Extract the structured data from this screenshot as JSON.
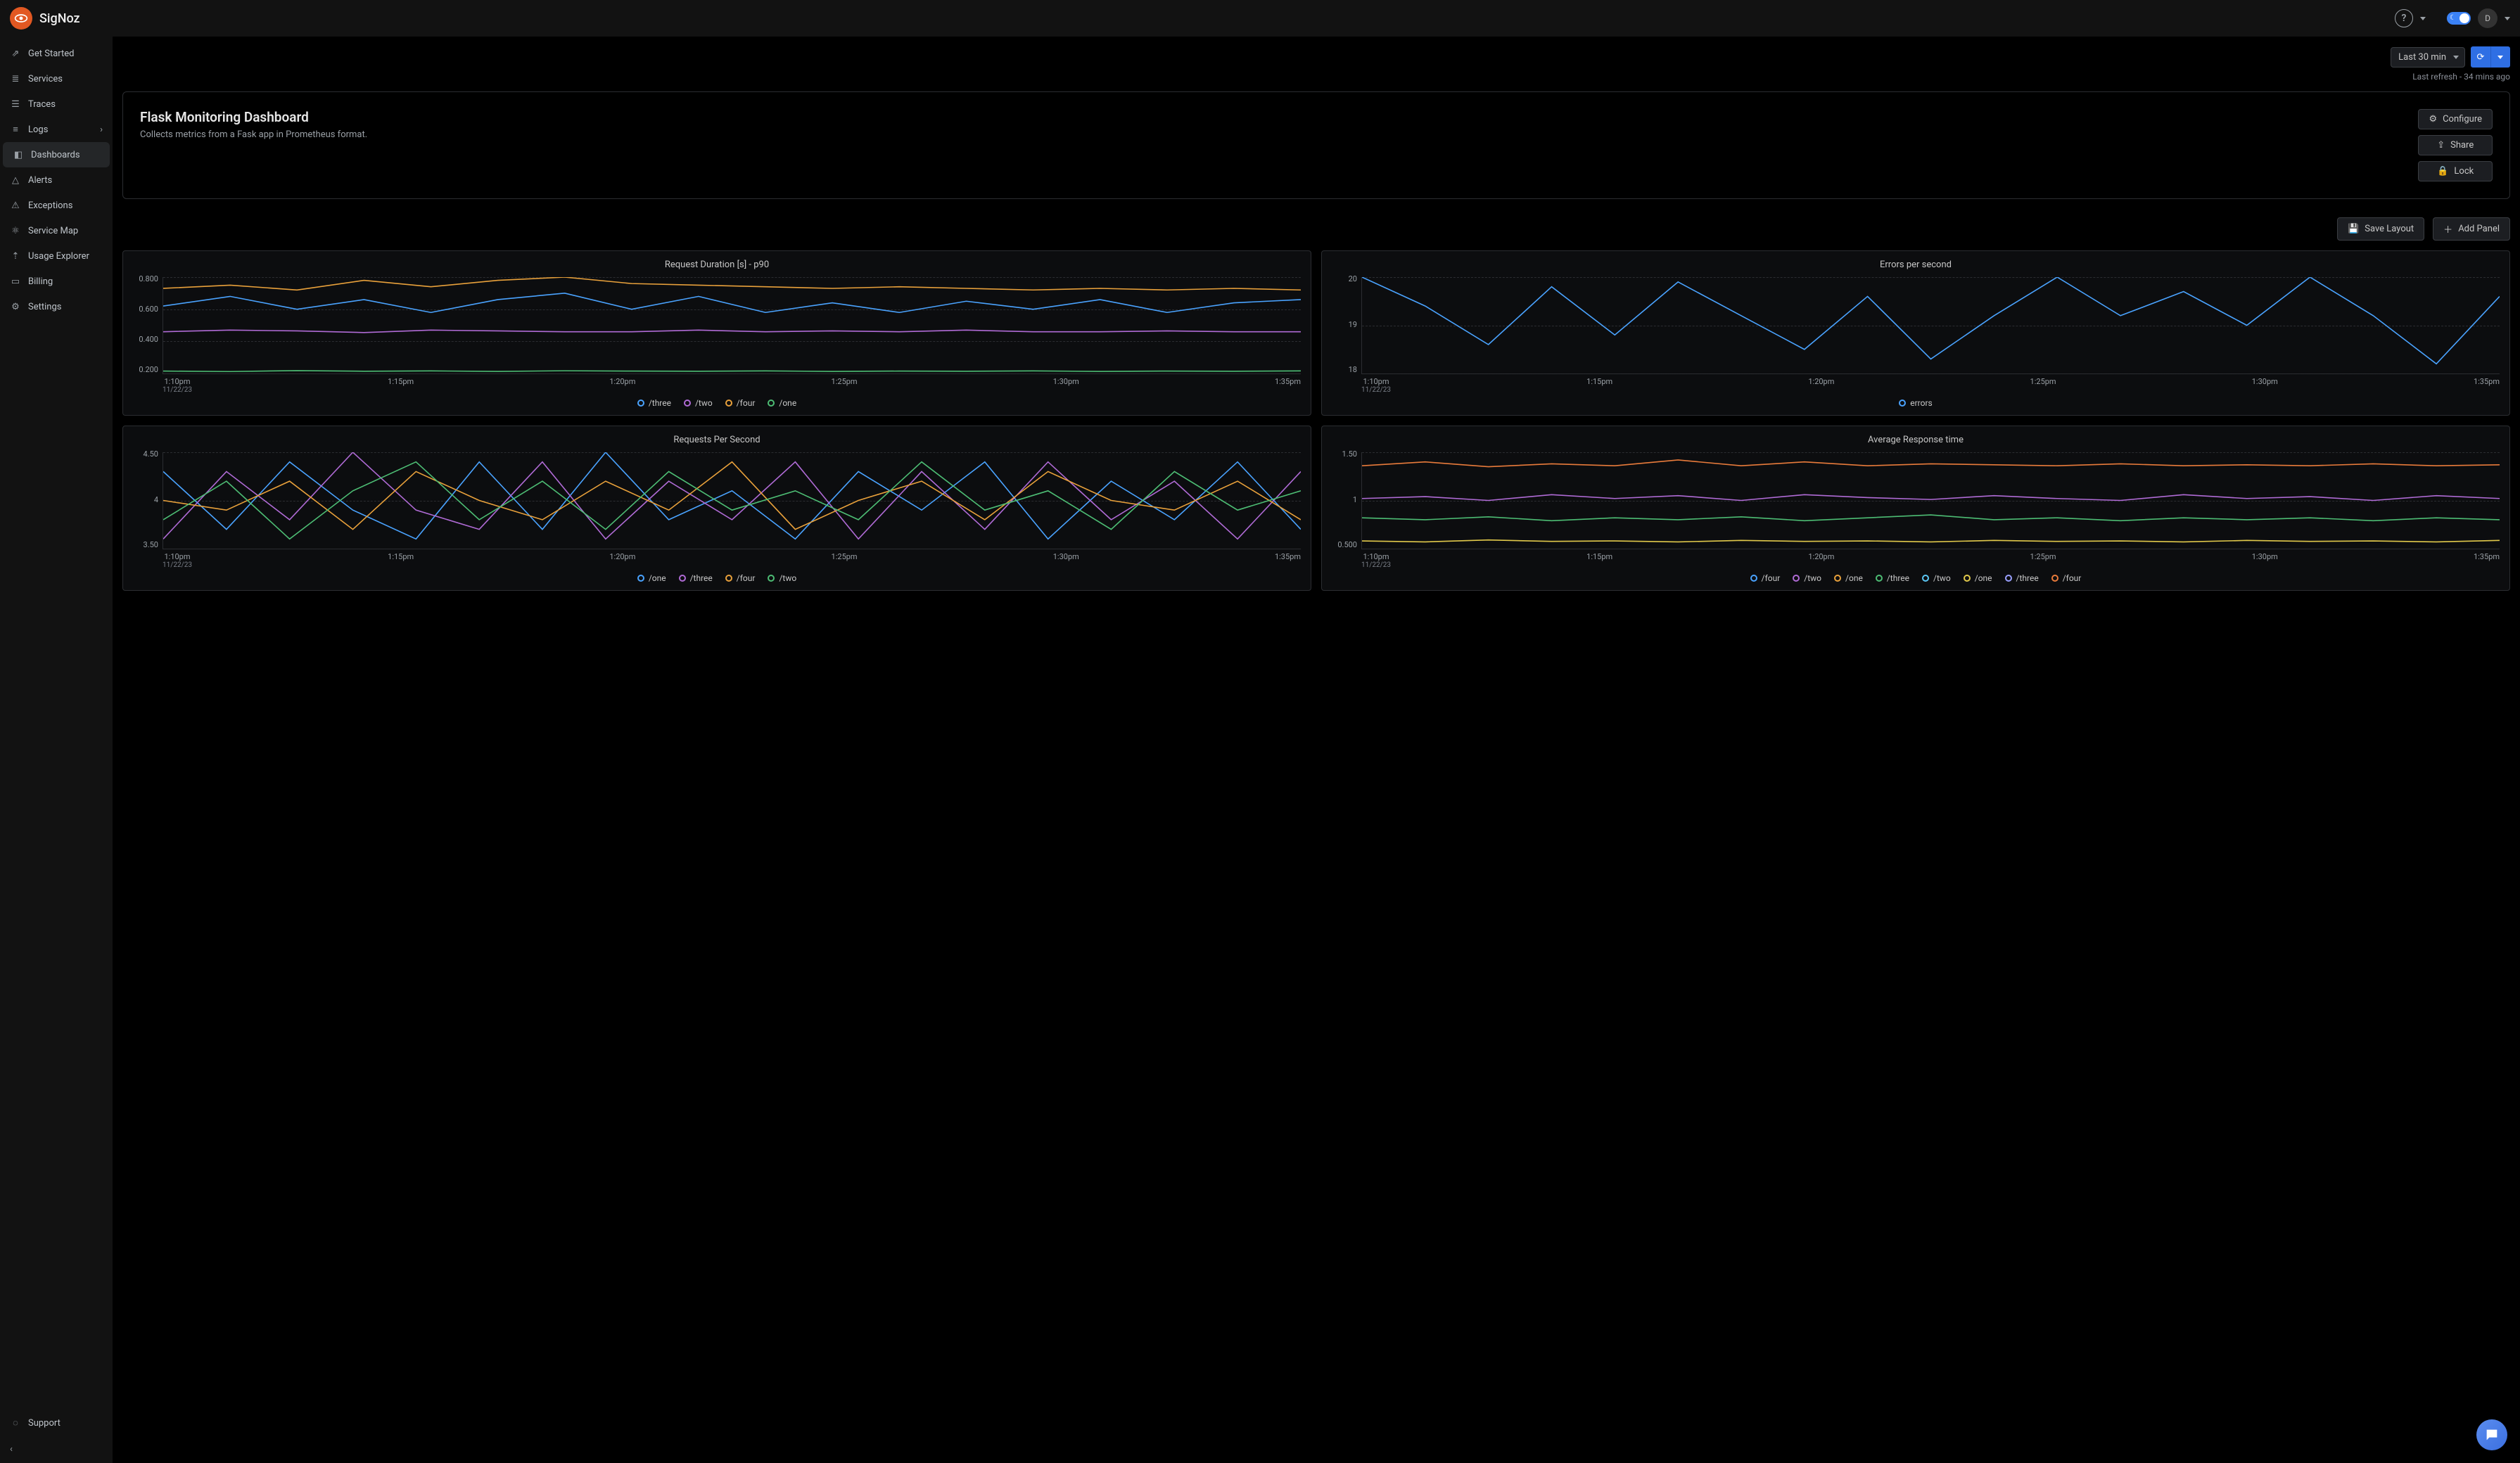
{
  "brand": "SigNoz",
  "header": {
    "help_tooltip": "Help",
    "theme": "dark",
    "avatar_initial": "D"
  },
  "sidebar": {
    "items": [
      {
        "label": "Get Started",
        "icon": "rocket-icon"
      },
      {
        "label": "Services",
        "icon": "bars-icon"
      },
      {
        "label": "Traces",
        "icon": "list-icon"
      },
      {
        "label": "Logs",
        "icon": "lines-icon",
        "has_submenu": true
      },
      {
        "label": "Dashboards",
        "icon": "dashboard-icon",
        "active": true
      },
      {
        "label": "Alerts",
        "icon": "bell-icon"
      },
      {
        "label": "Exceptions",
        "icon": "warning-icon"
      },
      {
        "label": "Service Map",
        "icon": "graph-icon"
      },
      {
        "label": "Usage Explorer",
        "icon": "chart-icon"
      },
      {
        "label": "Billing",
        "icon": "card-icon"
      },
      {
        "label": "Settings",
        "icon": "gear-icon"
      }
    ],
    "support_label": "Support"
  },
  "time_range": "Last 30 min",
  "refresh_label": "Last refresh - 34 mins ago",
  "dashboard": {
    "title": "Flask Monitoring Dashboard",
    "subtitle": "Collects metrics from a Fask app in Prometheus format.",
    "actions": {
      "configure": "Configure",
      "share": "Share",
      "lock": "Lock"
    }
  },
  "toolbar": {
    "save_layout": "Save Layout",
    "add_panel": "Add Panel"
  },
  "panels": [
    {
      "title": "Request Duration [s] - p90",
      "legend": [
        {
          "label": "/three",
          "color": "#4aa3ff"
        },
        {
          "label": "/two",
          "color": "#b06bd6"
        },
        {
          "label": "/four",
          "color": "#e9a13b"
        },
        {
          "label": "/one",
          "color": "#4dbd74"
        }
      ],
      "chart_data": {
        "type": "line",
        "xlabel": "",
        "ylabel": "",
        "ylim": [
          0.2,
          0.8
        ],
        "y_ticks": [
          "0.800",
          "0.600",
          "0.400",
          "0.200"
        ],
        "x_ticks": [
          "1:10pm",
          "1:15pm",
          "1:20pm",
          "1:25pm",
          "1:30pm",
          "1:35pm"
        ],
        "x_date": "11/22/23",
        "series": [
          {
            "name": "/four",
            "color": "#e9a13b",
            "values": [
              0.73,
              0.75,
              0.72,
              0.78,
              0.74,
              0.78,
              0.8,
              0.76,
              0.75,
              0.74,
              0.73,
              0.74,
              0.73,
              0.72,
              0.73,
              0.72,
              0.73,
              0.72
            ]
          },
          {
            "name": "/three",
            "color": "#4aa3ff",
            "values": [
              0.62,
              0.68,
              0.6,
              0.66,
              0.58,
              0.66,
              0.7,
              0.6,
              0.68,
              0.58,
              0.64,
              0.58,
              0.65,
              0.6,
              0.66,
              0.58,
              0.64,
              0.66
            ]
          },
          {
            "name": "/two",
            "color": "#b06bd6",
            "values": [
              0.46,
              0.47,
              0.465,
              0.455,
              0.47,
              0.465,
              0.46,
              0.46,
              0.47,
              0.46,
              0.465,
              0.46,
              0.47,
              0.46,
              0.46,
              0.465,
              0.46,
              0.46
            ]
          },
          {
            "name": "/one",
            "color": "#4dbd74",
            "values": [
              0.215,
              0.212,
              0.218,
              0.214,
              0.216,
              0.213,
              0.217,
              0.215,
              0.214,
              0.216,
              0.213,
              0.215,
              0.214,
              0.216,
              0.213,
              0.215,
              0.214,
              0.216
            ]
          }
        ]
      }
    },
    {
      "title": "Errors per second",
      "legend": [
        {
          "label": "errors",
          "color": "#4aa3ff"
        }
      ],
      "chart_data": {
        "type": "line",
        "xlabel": "",
        "ylabel": "",
        "ylim": [
          18,
          20
        ],
        "y_ticks": [
          "20",
          "19",
          "18"
        ],
        "x_ticks": [
          "1:10pm",
          "1:15pm",
          "1:20pm",
          "1:25pm",
          "1:30pm",
          "1:35pm"
        ],
        "x_date": "11/22/23",
        "series": [
          {
            "name": "errors",
            "color": "#4aa3ff",
            "values": [
              20.0,
              19.4,
              18.6,
              19.8,
              18.8,
              19.9,
              19.2,
              18.5,
              19.6,
              18.3,
              19.2,
              20.0,
              19.2,
              19.7,
              19.0,
              20.0,
              19.2,
              18.2,
              19.6
            ]
          }
        ]
      }
    },
    {
      "title": "Requests Per Second",
      "legend": [
        {
          "label": "/one",
          "color": "#4aa3ff"
        },
        {
          "label": "/three",
          "color": "#b06bd6"
        },
        {
          "label": "/four",
          "color": "#e9a13b"
        },
        {
          "label": "/two",
          "color": "#4dbd74"
        }
      ],
      "chart_data": {
        "type": "line",
        "xlabel": "",
        "ylabel": "",
        "ylim": [
          3.5,
          4.5
        ],
        "y_ticks": [
          "4.50",
          "4",
          "3.50"
        ],
        "x_ticks": [
          "1:10pm",
          "1:15pm",
          "1:20pm",
          "1:25pm",
          "1:30pm",
          "1:35pm"
        ],
        "x_date": "11/22/23",
        "series": [
          {
            "name": "/one",
            "color": "#4aa3ff",
            "values": [
              4.3,
              3.7,
              4.4,
              3.9,
              3.6,
              4.4,
              3.7,
              4.5,
              3.8,
              4.1,
              3.6,
              4.3,
              3.9,
              4.4,
              3.6,
              4.2,
              3.8,
              4.4,
              3.7
            ]
          },
          {
            "name": "/three",
            "color": "#b06bd6",
            "values": [
              3.6,
              4.3,
              3.8,
              4.5,
              3.9,
              3.7,
              4.4,
              3.6,
              4.2,
              3.8,
              4.4,
              3.6,
              4.3,
              3.7,
              4.4,
              3.8,
              4.2,
              3.6,
              4.3
            ]
          },
          {
            "name": "/four",
            "color": "#e9a13b",
            "values": [
              4.0,
              3.9,
              4.2,
              3.7,
              4.3,
              4.0,
              3.8,
              4.2,
              3.9,
              4.4,
              3.7,
              4.0,
              4.2,
              3.8,
              4.3,
              4.0,
              3.9,
              4.2,
              3.8
            ]
          },
          {
            "name": "/two",
            "color": "#4dbd74",
            "values": [
              3.8,
              4.2,
              3.6,
              4.1,
              4.4,
              3.8,
              4.2,
              3.7,
              4.3,
              3.9,
              4.1,
              3.8,
              4.4,
              3.9,
              4.1,
              3.7,
              4.3,
              3.9,
              4.1
            ]
          }
        ]
      }
    },
    {
      "title": "Average Response time",
      "legend": [
        {
          "label": "/four",
          "color": "#4aa3ff"
        },
        {
          "label": "/two",
          "color": "#b06bd6"
        },
        {
          "label": "/one",
          "color": "#e9a13b"
        },
        {
          "label": "/three",
          "color": "#4dbd74"
        },
        {
          "label": "/two",
          "color": "#5bc8f5"
        },
        {
          "label": "/one",
          "color": "#e1c94b"
        },
        {
          "label": "/three",
          "color": "#9aa0ff"
        },
        {
          "label": "/four",
          "color": "#e97b3b"
        }
      ],
      "chart_data": {
        "type": "line",
        "xlabel": "",
        "ylabel": "",
        "ylim": [
          0.5,
          1.5
        ],
        "y_ticks": [
          "1.50",
          "1",
          "0.500"
        ],
        "x_ticks": [
          "1:10pm",
          "1:15pm",
          "1:20pm",
          "1:25pm",
          "1:30pm",
          "1:35pm"
        ],
        "x_date": "11/22/23",
        "series": [
          {
            "name": "/four-top",
            "color": "#e97b3b",
            "values": [
              1.36,
              1.4,
              1.35,
              1.38,
              1.36,
              1.42,
              1.36,
              1.4,
              1.36,
              1.38,
              1.37,
              1.36,
              1.38,
              1.36,
              1.37,
              1.36,
              1.38,
              1.36,
              1.37
            ]
          },
          {
            "name": "/two",
            "color": "#b06bd6",
            "values": [
              1.02,
              1.04,
              1.0,
              1.06,
              1.02,
              1.05,
              1.0,
              1.06,
              1.03,
              1.01,
              1.05,
              1.02,
              1.0,
              1.06,
              1.02,
              1.04,
              1.0,
              1.05,
              1.02
            ]
          },
          {
            "name": "/three",
            "color": "#4dbd74",
            "values": [
              0.82,
              0.8,
              0.83,
              0.79,
              0.82,
              0.8,
              0.83,
              0.79,
              0.82,
              0.85,
              0.8,
              0.82,
              0.79,
              0.82,
              0.8,
              0.82,
              0.79,
              0.82,
              0.8
            ]
          },
          {
            "name": "/one",
            "color": "#e1c94b",
            "values": [
              0.58,
              0.57,
              0.59,
              0.575,
              0.58,
              0.57,
              0.585,
              0.575,
              0.58,
              0.57,
              0.585,
              0.575,
              0.58,
              0.57,
              0.585,
              0.575,
              0.58,
              0.57,
              0.585
            ]
          }
        ]
      }
    }
  ]
}
